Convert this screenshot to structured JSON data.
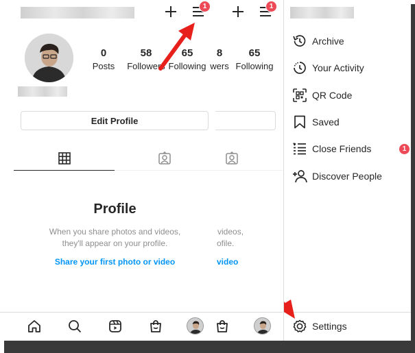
{
  "profile": {
    "stats": [
      {
        "value": "0",
        "label": "Posts"
      },
      {
        "value": "58",
        "label": "Followers"
      },
      {
        "value": "65",
        "label": "Following"
      }
    ],
    "ghost_stats": [
      {
        "value": "8",
        "label": "wers"
      },
      {
        "value": "65",
        "label": "Following"
      }
    ],
    "edit_profile_label": "Edit Profile",
    "notification_count": "1"
  },
  "empty_state": {
    "title": "Profile",
    "line1": "When you share photos and videos,",
    "line2": "they'll appear on your profile.",
    "link": "Share your first photo or video",
    "ghost_line1": "videos,",
    "ghost_line2": "ofile.",
    "ghost_link": "video"
  },
  "menu": {
    "items": [
      {
        "label": "Archive",
        "icon": "archive-icon"
      },
      {
        "label": "Your Activity",
        "icon": "activity-icon"
      },
      {
        "label": "QR Code",
        "icon": "qr-code-icon"
      },
      {
        "label": "Saved",
        "icon": "bookmark-icon"
      },
      {
        "label": "Close Friends",
        "icon": "close-friends-icon",
        "badge": "1"
      },
      {
        "label": "Discover People",
        "icon": "add-person-icon"
      }
    ],
    "settings_label": "Settings"
  },
  "colors": {
    "badge": "#ed4956",
    "link": "#0095f6",
    "arrow": "#e8201c"
  }
}
